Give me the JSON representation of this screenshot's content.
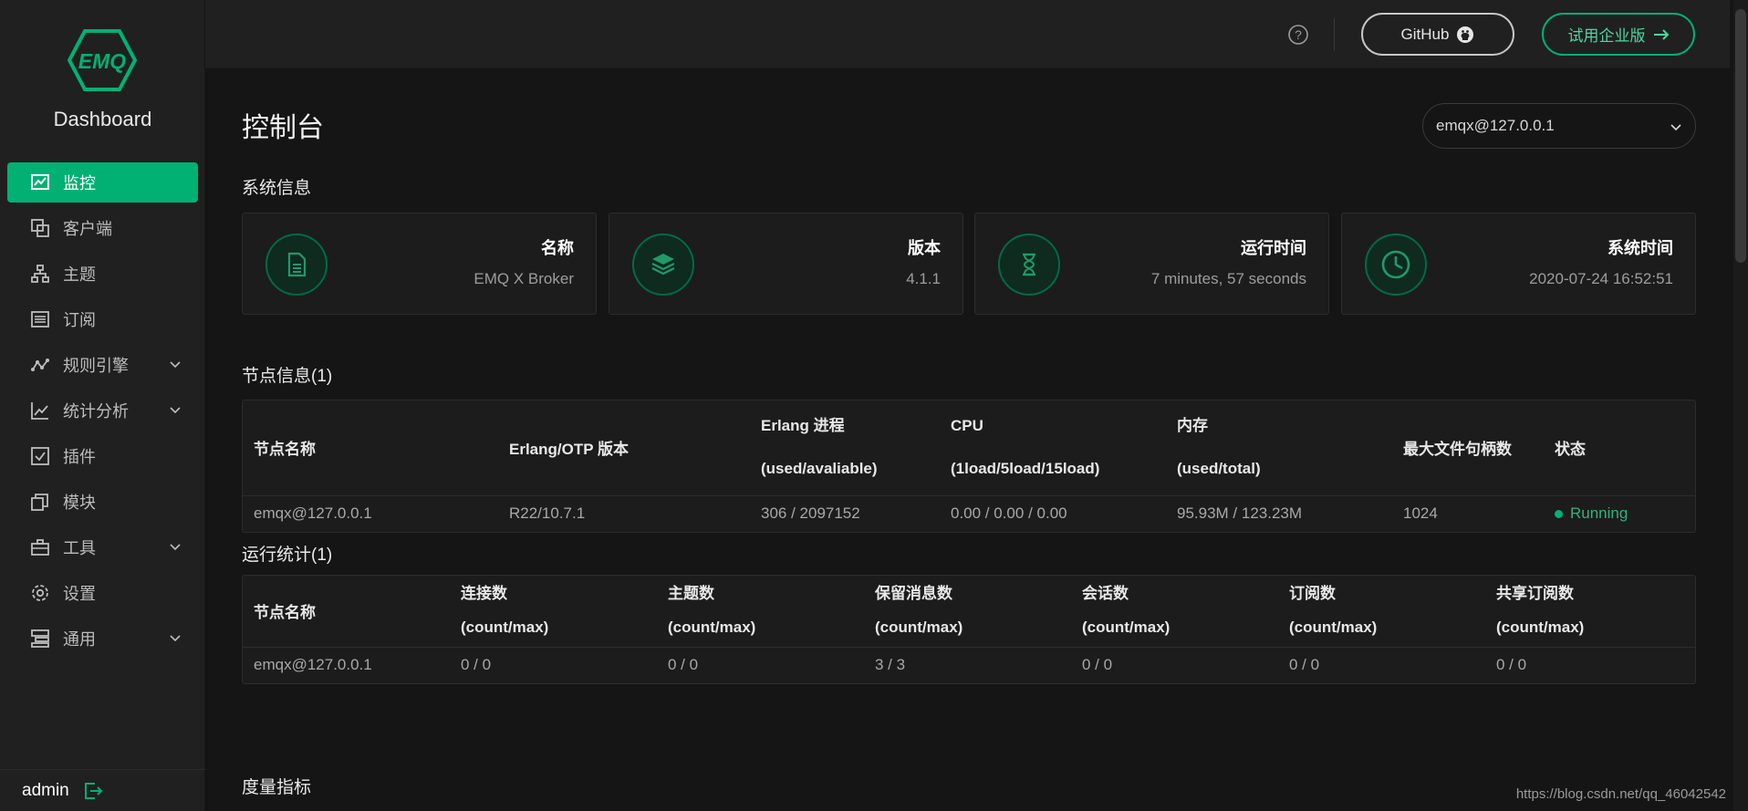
{
  "brand": {
    "logo_text": "EMQ",
    "name": "Dashboard"
  },
  "sidebar": {
    "items": [
      {
        "label": "监控",
        "icon": "monitor-icon",
        "active": true
      },
      {
        "label": "客户端",
        "icon": "clients-icon"
      },
      {
        "label": "主题",
        "icon": "topics-icon"
      },
      {
        "label": "订阅",
        "icon": "subscriptions-icon"
      },
      {
        "label": "规则引擎",
        "icon": "rule-engine-icon",
        "has_children": true
      },
      {
        "label": "统计分析",
        "icon": "analytics-icon",
        "has_children": true
      },
      {
        "label": "插件",
        "icon": "plugins-icon"
      },
      {
        "label": "模块",
        "icon": "modules-icon"
      },
      {
        "label": "工具",
        "icon": "tools-icon",
        "has_children": true
      },
      {
        "label": "设置",
        "icon": "settings-icon"
      },
      {
        "label": "通用",
        "icon": "general-icon",
        "has_children": true
      }
    ],
    "user": "admin"
  },
  "header": {
    "github_label": "GitHub",
    "enterprise_label": "试用企业版"
  },
  "page": {
    "title": "控制台",
    "node_select": "emqx@127.0.0.1"
  },
  "system_info": {
    "title": "系统信息",
    "cards": [
      {
        "label": "名称",
        "value": "EMQ X Broker",
        "icon": "document-icon"
      },
      {
        "label": "版本",
        "value": "4.1.1",
        "icon": "layers-icon"
      },
      {
        "label": "运行时间",
        "value": "7 minutes, 57 seconds",
        "icon": "hourglass-icon"
      },
      {
        "label": "系统时间",
        "value": "2020-07-24 16:52:51",
        "icon": "clock-icon"
      }
    ]
  },
  "node_info": {
    "title": "节点信息(1)",
    "columns": [
      {
        "l1": "节点名称"
      },
      {
        "l1": "Erlang/OTP 版本"
      },
      {
        "l1": "Erlang 进程",
        "l2": "(used/avaliable)"
      },
      {
        "l1": "CPU",
        "l2": "(1load/5load/15load)"
      },
      {
        "l1": "内存",
        "l2": "(used/total)"
      },
      {
        "l1": "最大文件句柄数"
      },
      {
        "l1": "状态"
      }
    ],
    "rows": [
      [
        "emqx@127.0.0.1",
        "R22/10.7.1",
        "306 / 2097152",
        "0.00 / 0.00 / 0.00",
        "95.93M / 123.23M",
        "1024",
        "Running"
      ]
    ]
  },
  "run_stats": {
    "title": "运行统计(1)",
    "columns": [
      {
        "l1": "节点名称"
      },
      {
        "l1": "连接数",
        "l2": "(count/max)"
      },
      {
        "l1": "主题数",
        "l2": "(count/max)"
      },
      {
        "l1": "保留消息数",
        "l2": "(count/max)"
      },
      {
        "l1": "会话数",
        "l2": "(count/max)"
      },
      {
        "l1": "订阅数",
        "l2": "(count/max)"
      },
      {
        "l1": "共享订阅数",
        "l2": "(count/max)"
      }
    ],
    "rows": [
      [
        "emqx@127.0.0.1",
        "0 / 0",
        "0 / 0",
        "3 / 3",
        "0 / 0",
        "0 / 0",
        "0 / 0"
      ]
    ]
  },
  "metrics": {
    "title": "度量指标"
  },
  "watermark": "https://blog.csdn.net/qq_46042542",
  "colors": {
    "accent": "#00b173",
    "sidebar_bg": "#202020",
    "body_bg": "#151515"
  }
}
